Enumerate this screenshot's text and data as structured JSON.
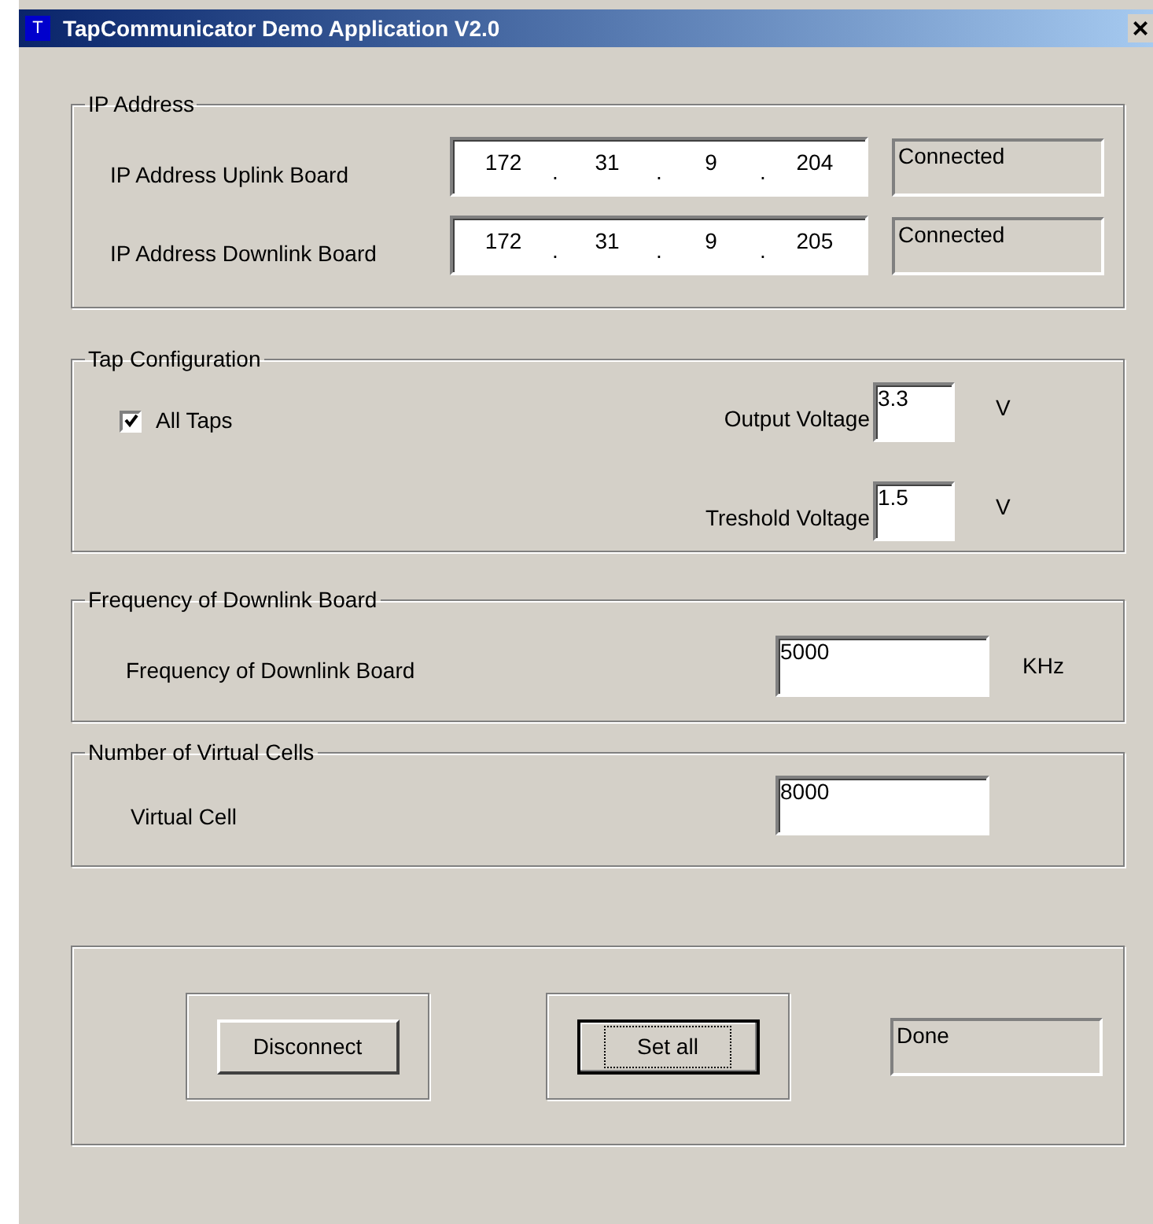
{
  "window": {
    "title": "TapCommunicator Demo Application V2.0",
    "icon_letter": "T",
    "close": "×"
  },
  "ip_group": {
    "title": "IP Address",
    "rows": [
      {
        "label": "IP Address Uplink Board",
        "octets": [
          "172",
          "31",
          "9",
          "204"
        ],
        "status": "Connected"
      },
      {
        "label": "IP Address Downlink Board",
        "octets": [
          "172",
          "31",
          "9",
          "205"
        ],
        "status": "Connected"
      }
    ],
    "separator": "."
  },
  "tap_group": {
    "title": "Tap Configuration",
    "all_taps": {
      "label": "All Taps",
      "checked": true
    },
    "voltages": [
      {
        "label": "Output Voltage",
        "value": "3.3",
        "unit": "V"
      },
      {
        "label": "Treshold Voltage",
        "value": "1.5",
        "unit": "V"
      }
    ]
  },
  "frequency_group": {
    "title": "Frequency of Downlink Board",
    "label": "Frequency of Downlink Board",
    "value": "5000",
    "unit": "KHz"
  },
  "cells_group": {
    "title": "Number of Virtual Cells",
    "label": "Virtual Cell",
    "value": "8000"
  },
  "actions": {
    "buttons": [
      {
        "label": "Disconnect",
        "focused": false
      },
      {
        "label": "Set all",
        "focused": true
      }
    ],
    "status": "Done"
  }
}
